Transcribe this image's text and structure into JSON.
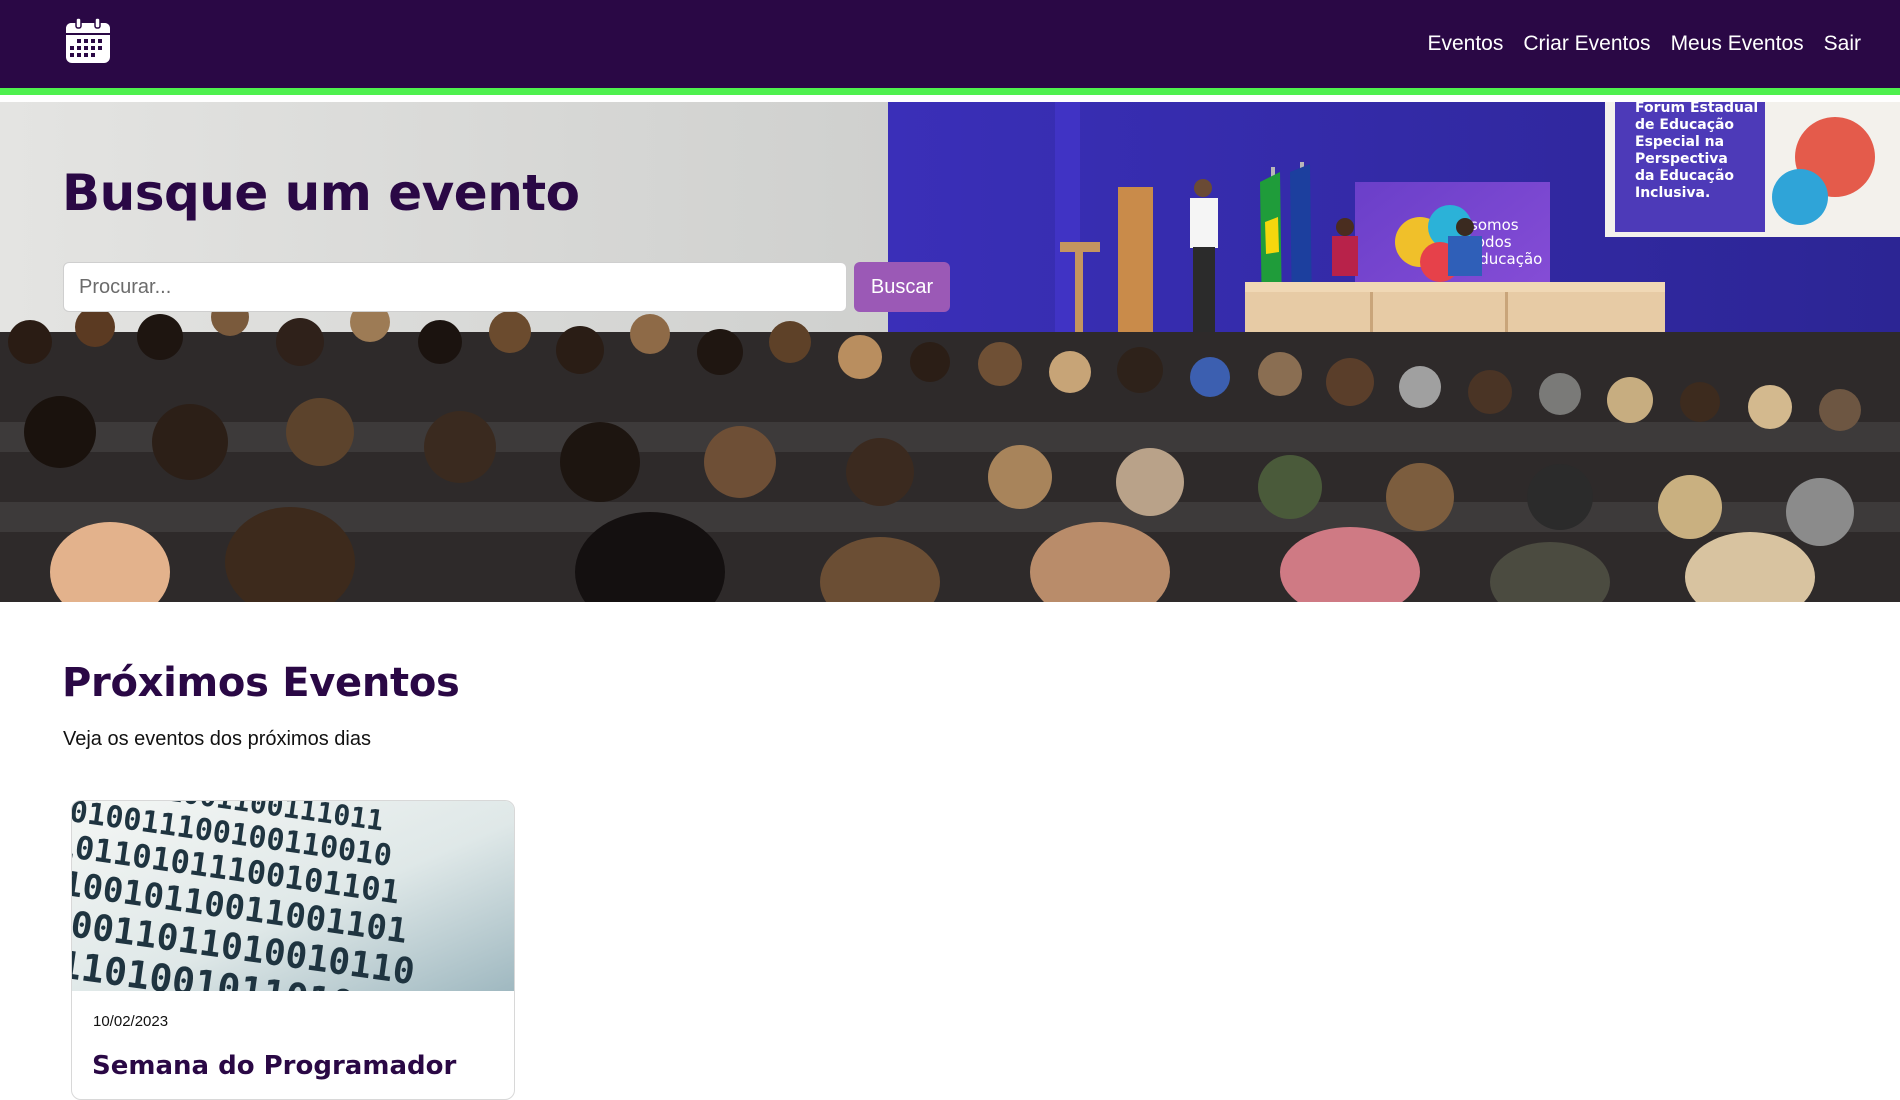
{
  "navbar": {
    "brand_icon": "calendar-icon",
    "links": [
      "Eventos",
      "Criar Eventos",
      "Meus Eventos",
      "Sair"
    ]
  },
  "hero": {
    "title": "Busque um evento",
    "search": {
      "placeholder": "Procurar...",
      "value": ""
    },
    "button_label": "Buscar",
    "banner_text": [
      "Forum Estadual",
      "de Educação",
      "Especial na",
      "Perspectiva",
      "da Educação",
      "Inclusiva."
    ],
    "stage_panel_text": [
      "somos",
      "todos",
      "educação"
    ]
  },
  "section": {
    "title": "Próximos Eventos",
    "subtitle": "Veja os eventos dos próximos dias"
  },
  "events": [
    {
      "date": "10/02/2023",
      "title": "Semana do Programador",
      "image_icon": "binary-code-image"
    }
  ],
  "colors": {
    "navbar_bg": "#2a0845",
    "navbar_accent": "#4ef04e",
    "heading": "#2a0845",
    "button": "#9b59b6"
  }
}
